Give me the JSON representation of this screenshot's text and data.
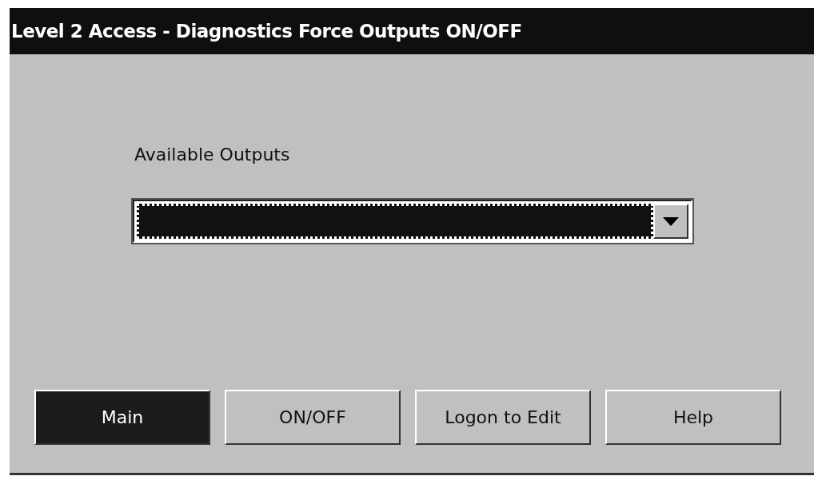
{
  "window": {
    "title": "Level 2 Access - Diagnostics Force Outputs ON/OFF"
  },
  "outputs": {
    "label": "Available Outputs",
    "dropdown": {
      "focused": true
    }
  },
  "buttons": [
    {
      "label": "Main",
      "selected": true
    },
    {
      "label": "ON/OFF",
      "selected": false
    },
    {
      "label": "Logon to Edit",
      "selected": false
    },
    {
      "label": "Help",
      "selected": false
    }
  ]
}
